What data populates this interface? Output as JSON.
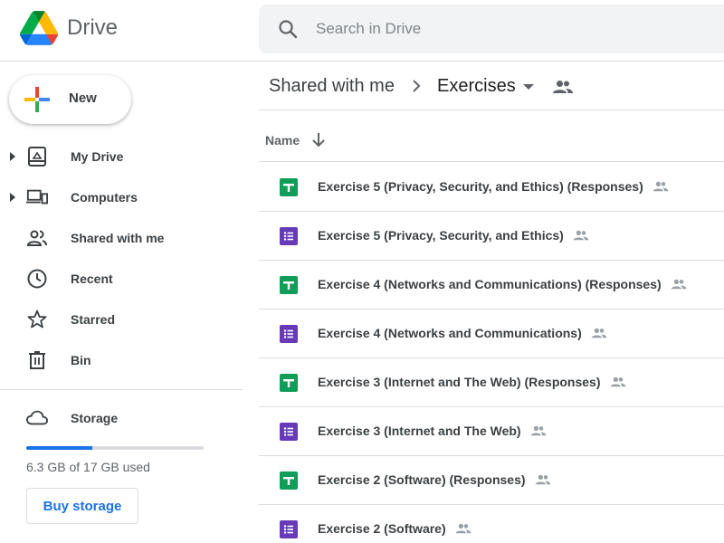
{
  "header": {
    "app_name": "Drive",
    "search_placeholder": "Search in Drive"
  },
  "sidebar": {
    "new_label": "New",
    "items": [
      {
        "label": "My Drive",
        "icon": "my-drive-icon",
        "expandable": true
      },
      {
        "label": "Computers",
        "icon": "computers-icon",
        "expandable": true
      },
      {
        "label": "Shared with me",
        "icon": "shared-with-me-icon",
        "expandable": false
      },
      {
        "label": "Recent",
        "icon": "clock-icon",
        "expandable": false
      },
      {
        "label": "Starred",
        "icon": "star-icon",
        "expandable": false
      },
      {
        "label": "Bin",
        "icon": "bin-icon",
        "expandable": false
      }
    ],
    "storage": {
      "label": "Storage",
      "used_text": "6.3 GB of 17 GB used",
      "used_fraction": 0.37,
      "buy_label": "Buy storage"
    }
  },
  "main": {
    "breadcrumb": {
      "parent": "Shared with me",
      "current": "Exercises"
    },
    "column_name": "Name",
    "files": [
      {
        "name": "Exercise 5 (Privacy, Security, and Ethics) (Responses)",
        "type": "sheets"
      },
      {
        "name": "Exercise 5 (Privacy, Security, and Ethics)",
        "type": "forms"
      },
      {
        "name": "Exercise 4 (Networks and Communications) (Responses)",
        "type": "sheets"
      },
      {
        "name": "Exercise 4 (Networks and Communications)",
        "type": "forms"
      },
      {
        "name": "Exercise 3 (Internet and The Web) (Responses)",
        "type": "sheets"
      },
      {
        "name": "Exercise 3 (Internet and The Web)",
        "type": "forms"
      },
      {
        "name": "Exercise 2 (Software) (Responses)",
        "type": "sheets"
      },
      {
        "name": "Exercise 2 (Software)",
        "type": "forms"
      }
    ]
  },
  "colors": {
    "sheets": "#0f9d58",
    "forms": "#673ab7",
    "accent": "#1a73e8"
  }
}
